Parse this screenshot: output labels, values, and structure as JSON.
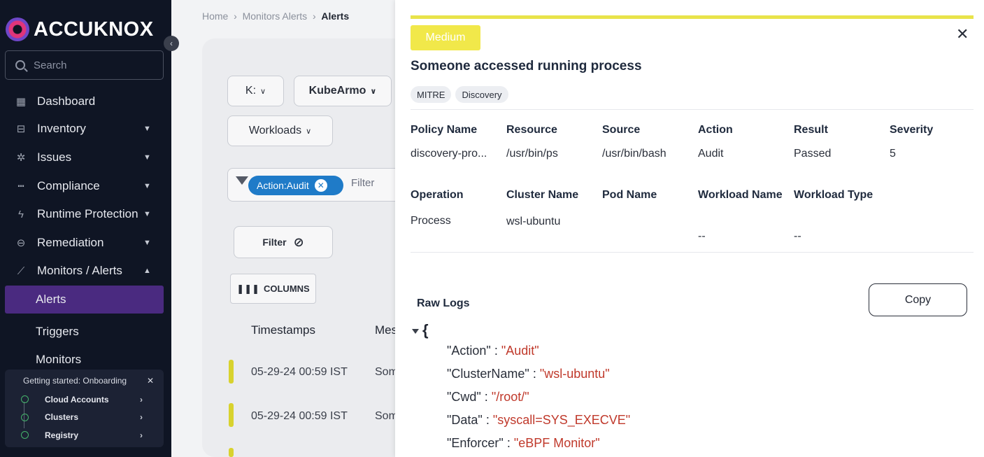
{
  "sidebar": {
    "logo_text": "ACCUKNOX",
    "search_placeholder": "Search",
    "nav": [
      {
        "label": "Dashboard",
        "icon": "dashboard-icon",
        "has_chevron": false
      },
      {
        "label": "Inventory",
        "icon": "inventory-icon",
        "chevron": "chevron-down"
      },
      {
        "label": "Issues",
        "icon": "bug-icon",
        "chevron": "chevron-down"
      },
      {
        "label": "Compliance",
        "icon": "compliance-icon",
        "chevron": "chevron-down"
      },
      {
        "label": "Runtime Protection",
        "icon": "lightning-icon",
        "chevron": "chevron-down"
      },
      {
        "label": "Remediation",
        "icon": "lock-icon",
        "chevron": "chevron-down"
      },
      {
        "label": "Monitors / Alerts",
        "icon": "chart-line-icon",
        "chevron": "chevron-up"
      }
    ],
    "sub_items": [
      "Alerts",
      "Triggers",
      "Monitors"
    ],
    "onboarding": {
      "title": "Getting started: Onboarding",
      "items": [
        "Cloud Accounts",
        "Clusters",
        "Registry"
      ]
    }
  },
  "breadcrumb": {
    "home": "Home",
    "parent": "Monitors Alerts",
    "current": "Alerts"
  },
  "toolbar": {
    "k_select": "K:",
    "source_select": "KubeArmo",
    "workloads_select": "Workloads",
    "filter_chip": "Action:Audit",
    "filter_placeholder": "Filter",
    "filter_button": "Filter",
    "columns_button": "COLUMNS"
  },
  "table": {
    "headers": [
      "Timestamps",
      "Mes"
    ],
    "rows": [
      {
        "timestamp": "05-29-24 00:59 IST",
        "message": "Som"
      },
      {
        "timestamp": "05-29-24 00:59 IST",
        "message": "Som"
      }
    ]
  },
  "detail": {
    "severity_badge": "Medium",
    "title": "Someone accessed running process",
    "tags": [
      "MITRE",
      "Discovery"
    ],
    "fields_row1": {
      "headers": [
        "Policy Name",
        "Resource",
        "Source",
        "Action",
        "Result",
        "Severity"
      ],
      "values": [
        "discovery-pro...",
        "/usr/bin/ps",
        "/usr/bin/bash",
        "Audit",
        "Passed",
        "5"
      ]
    },
    "fields_row2": {
      "headers": [
        "Operation",
        "Cluster Name",
        "Pod Name",
        "Workload Name",
        "Workload Type"
      ],
      "values": [
        "Process",
        "wsl-ubuntu",
        "",
        "--",
        "--"
      ]
    },
    "raw_logs_title": "Raw Logs",
    "copy_button": "Copy",
    "json_open": "{",
    "raw_logs": [
      {
        "key": "\"Action\"",
        "value": "\"Audit\""
      },
      {
        "key": "\"ClusterName\"",
        "value": "\"wsl-ubuntu\""
      },
      {
        "key": "\"Cwd\"",
        "value": "\"/root/\""
      },
      {
        "key": "\"Data\"",
        "value": "\"syscall=SYS_EXECVE\""
      },
      {
        "key": "\"Enforcer\"",
        "value": "\"eBPF Monitor\""
      }
    ]
  },
  "colors": {
    "sidebar_bg": "#0f1524",
    "active_item": "#4a2a80",
    "medium_severity": "#f1e84a",
    "chip_blue": "#1f7bc8",
    "json_value": "#c0392b"
  }
}
